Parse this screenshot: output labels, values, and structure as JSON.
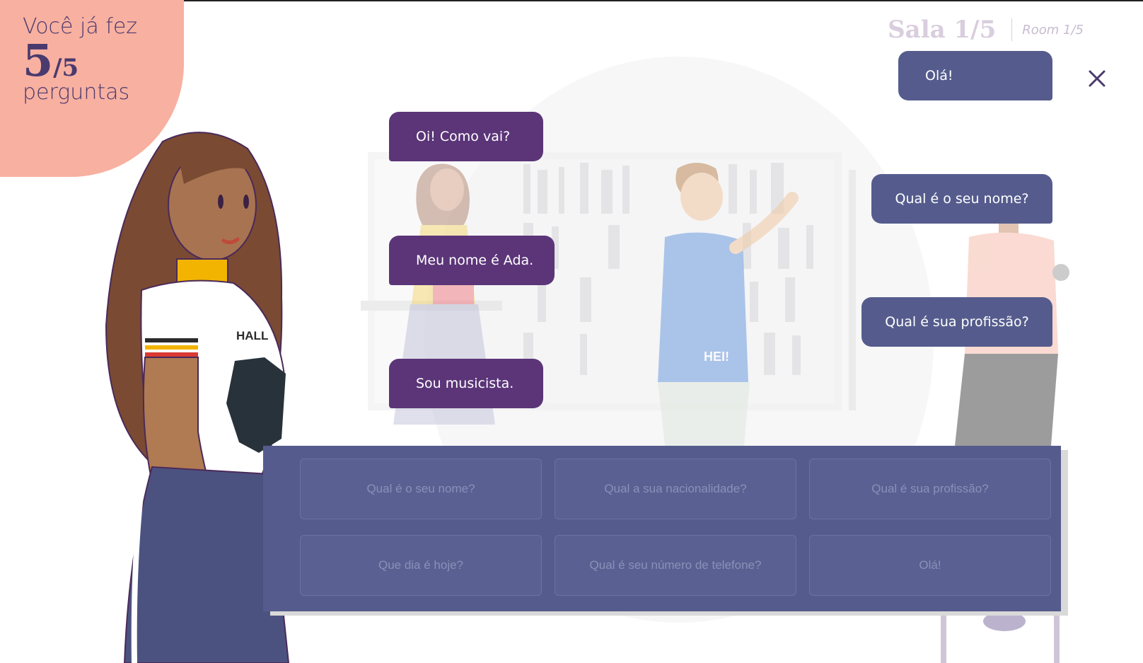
{
  "progress": {
    "prefix": "Você já fez",
    "count": "5",
    "total": "/5",
    "suffix": "perguntas"
  },
  "room": {
    "label_pt": "Sala 1/5",
    "label_en": "Room 1/5"
  },
  "close_icon": "close-icon",
  "dialog": {
    "left": [
      "Oi! Como vai?",
      "Meu nome é Ada.",
      "Sou musicista."
    ],
    "right": [
      "Olá!",
      "Qual é o seu nome?",
      "Qual é sua profissão?"
    ]
  },
  "illustrations": {
    "shirt_text_front": "HALL",
    "shirt_text_back": "HEI!"
  },
  "options": [
    "Qual é o seu nome?",
    "Qual a sua nacionalidade?",
    "Qual é sua profissão?",
    "Que dia é hoje?",
    "Qual é seu número de telefone?",
    "Olá!"
  ],
  "colors": {
    "accent_purple": "#5b3578",
    "accent_blue": "#555c8d",
    "counter_bg": "#f8b0a0"
  }
}
